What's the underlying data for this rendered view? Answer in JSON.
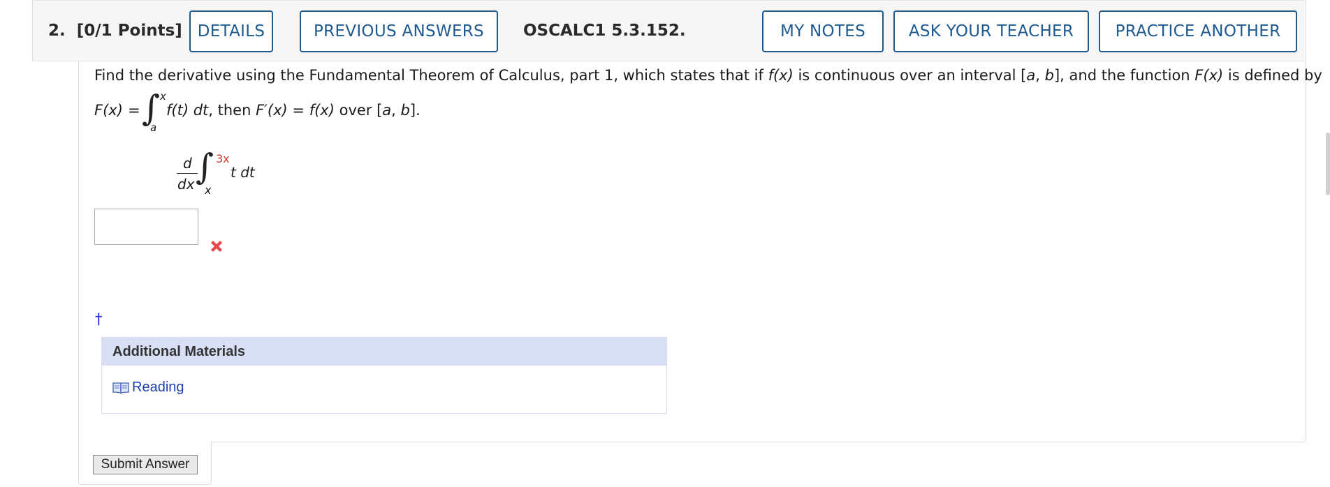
{
  "header": {
    "question_number": "2.",
    "points": "[0/1 Points]",
    "details_label": "DETAILS",
    "previous_answers_label": "PREVIOUS ANSWERS",
    "reference": "OSCALC1 5.3.152.",
    "my_notes_label": "MY NOTES",
    "ask_teacher_label": "ASK YOUR TEACHER",
    "practice_label": "PRACTICE ANOTHER"
  },
  "question": {
    "intro": "Find the derivative using the Fundamental Theorem of Calculus, part 1, which states that if ",
    "f_x": "f(x)",
    "mid1": " is continuous over an interval [",
    "a": "a",
    "comma": ", ",
    "b": "b",
    "mid2": "], and the function ",
    "F_x": "F(x)",
    "end": " is defined by",
    "def_lhs": "F(x)",
    "equals": "=",
    "def_upper": "x",
    "def_lower": "a",
    "def_integrand": "f(t) dt",
    "then": ", then ",
    "Fprime": "F′(x)",
    "eq": " = ",
    "f_x2": "f(x)",
    "over": " over [",
    "a2": "a",
    "comma2": ", ",
    "b2": "b",
    "close": "]."
  },
  "problem": {
    "d_num": "d",
    "d_den": "dx",
    "upper": "3x",
    "lower": "x",
    "integrand": "t dt"
  },
  "answer": {
    "value": "",
    "status": "incorrect"
  },
  "footnote_marker": "†",
  "additional_materials": {
    "title": "Additional Materials",
    "reading_label": "Reading",
    "icon": "book-icon"
  },
  "submit_label": "Submit Answer",
  "colors": {
    "button_border": "#1f5a8f",
    "incorrect_mark": "#e8474b",
    "upper_limit_red": "#d8342f",
    "materials_header": "#d9e0f6",
    "link": "#1a3db5"
  }
}
